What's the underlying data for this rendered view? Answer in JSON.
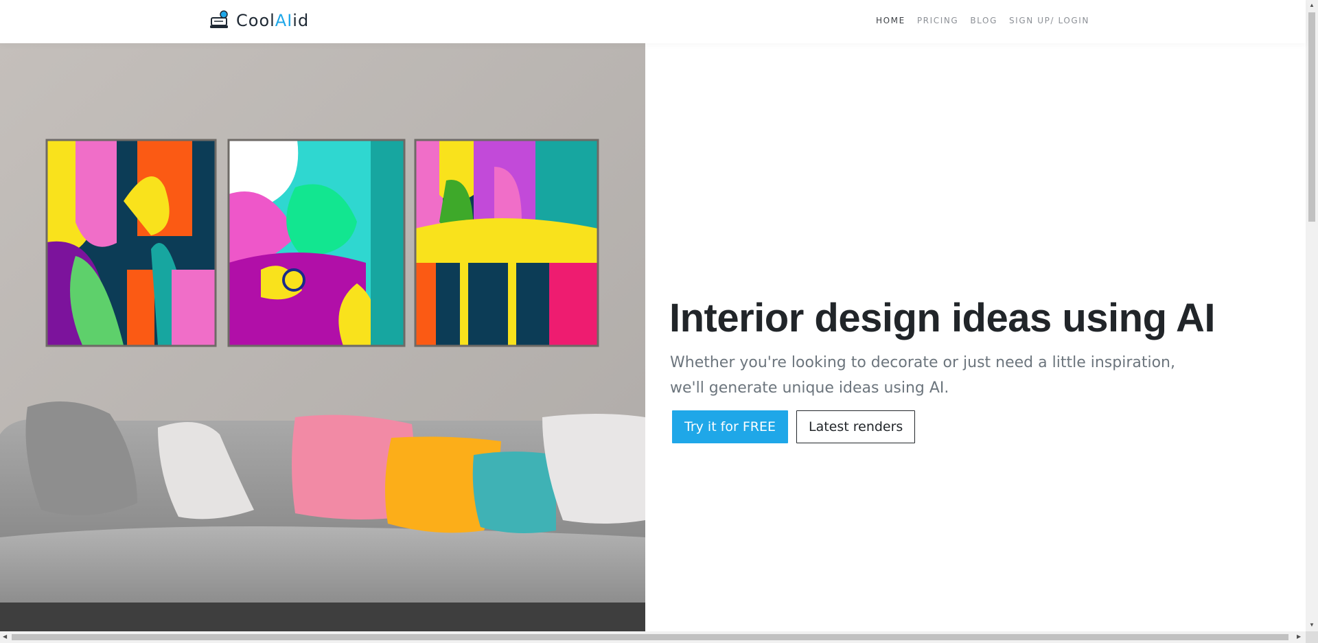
{
  "brand": {
    "name_prefix": "Cool",
    "name_ai": "AI",
    "name_suffix": "id",
    "accent_color": "#1fa7e8"
  },
  "nav": {
    "items": [
      {
        "label": "HOME",
        "active": true
      },
      {
        "label": "PRICING",
        "active": false
      },
      {
        "label": "BLOG",
        "active": false
      },
      {
        "label": "SIGN UP/ LOGIN",
        "active": false
      }
    ]
  },
  "hero": {
    "title": "Interior design ideas using AI",
    "subtitle": "Whether you're looking to decorate or just need a little inspiration, we'll generate unique ideas using AI.",
    "primary_button": "Try it for FREE",
    "secondary_button": "Latest renders",
    "image_subject": "living-room-sofa-with-abstract-art-triptych"
  },
  "icons": {
    "logo": "chat-bubble-laptop-icon",
    "scroll_up": "arrow-up-icon",
    "scroll_down": "arrow-down-icon",
    "scroll_left": "arrow-left-icon",
    "scroll_right": "arrow-right-icon"
  }
}
